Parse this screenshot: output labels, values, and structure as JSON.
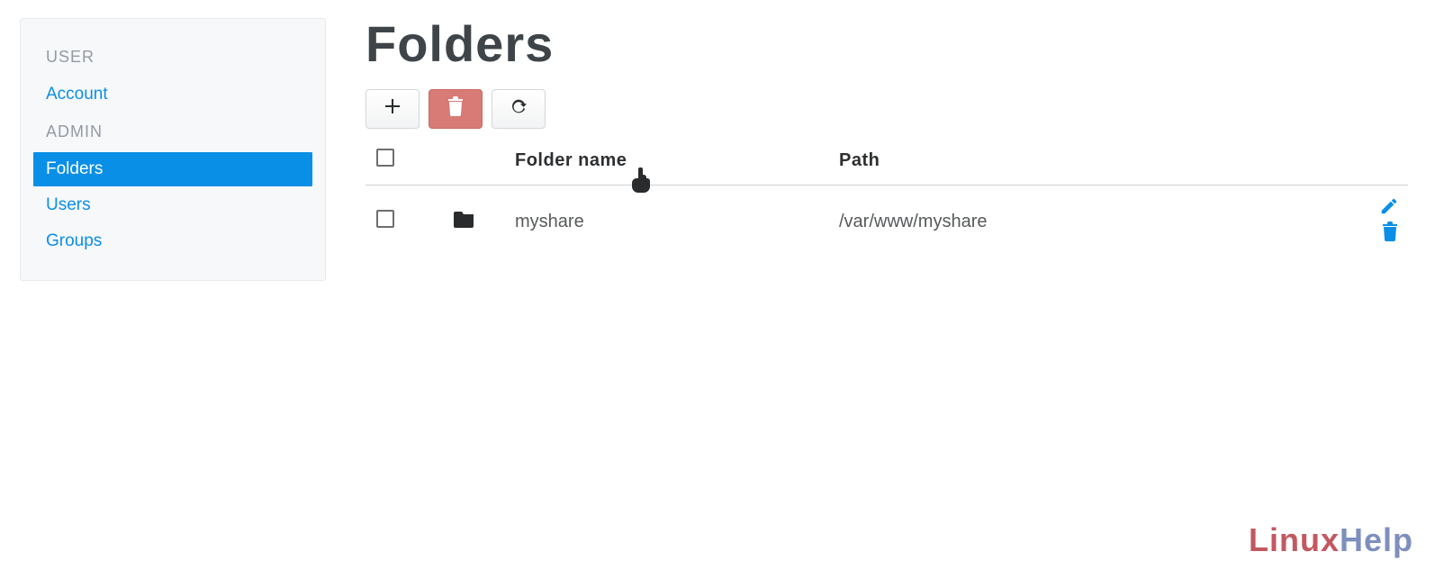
{
  "sidebar": {
    "sections": [
      {
        "label": "USER",
        "items": [
          {
            "label": "Account",
            "active": false
          }
        ]
      },
      {
        "label": "ADMIN",
        "items": [
          {
            "label": "Folders",
            "active": true
          },
          {
            "label": "Users",
            "active": false
          },
          {
            "label": "Groups",
            "active": false
          }
        ]
      }
    ]
  },
  "main": {
    "title": "Folders",
    "table": {
      "headers": {
        "name": "Folder name",
        "path": "Path"
      },
      "rows": [
        {
          "name": "myshare",
          "path": "/var/www/myshare"
        }
      ]
    }
  },
  "logo": {
    "text_a": "Linux",
    "text_b": "Help"
  }
}
